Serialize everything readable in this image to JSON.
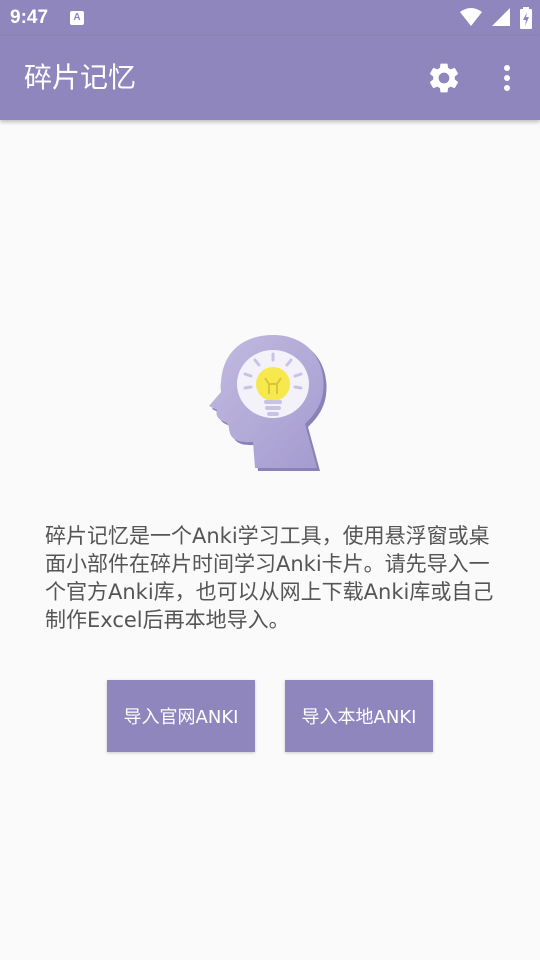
{
  "status_bar": {
    "time": "9:47",
    "notification_icon": "A",
    "icons": [
      "wifi-icon",
      "signal-icon",
      "battery-charging-icon"
    ]
  },
  "app_bar": {
    "title": "碎片记忆",
    "actions": [
      "settings-icon",
      "more-vert-icon"
    ]
  },
  "main": {
    "illustration": "head-with-lightbulb-icon",
    "description": "碎片记忆是一个Anki学习工具，使用悬浮窗或桌面小部件在碎片时间学习Anki卡片。请先导入一个官方Anki库，也可以从网上下载Anki库或自己制作Excel后再本地导入。",
    "buttons": {
      "import_official": "导入官网ANKI",
      "import_local": "导入本地ANKI"
    }
  },
  "colors": {
    "primary": "#8f86bd",
    "background": "#fafafa",
    "text": "#555555",
    "bulb": "#f7e84e"
  }
}
